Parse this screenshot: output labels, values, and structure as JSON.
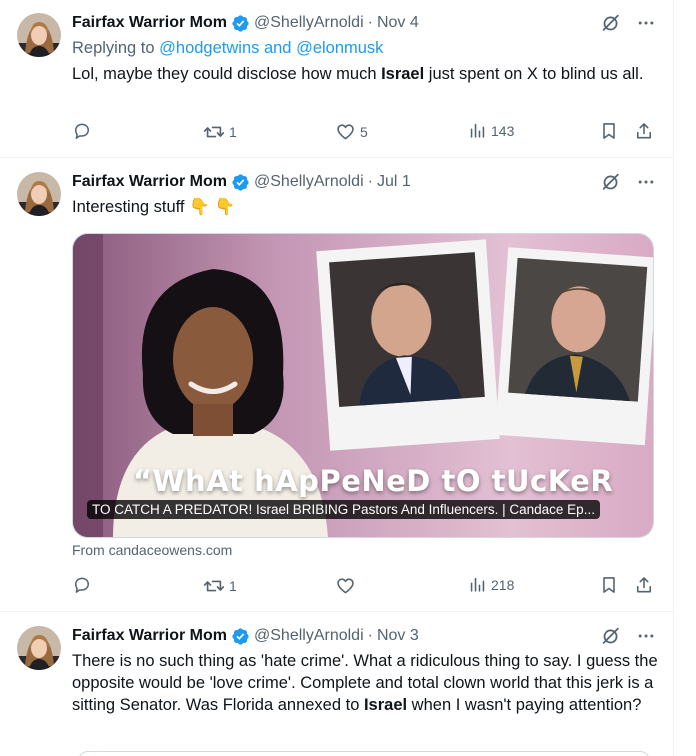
{
  "colors": {
    "accent": "#1d9bf0",
    "muted": "#536471",
    "text": "#0f1419"
  },
  "tweets": [
    {
      "name": "Fairfax Warrior Mom",
      "handle": "@ShellyArnoldi",
      "dot": "·",
      "date": "Nov 4",
      "replying_prefix": "Replying to ",
      "replying_to": "@hodgetwins and @elonmusk",
      "text_before": "Lol, maybe they could disclose how much ",
      "text_bold": "Israel",
      "text_after": " just spent on X to blind us all.",
      "retweets": "1",
      "likes": "5",
      "views": "143"
    },
    {
      "name": "Fairfax Warrior Mom",
      "handle": "@ShellyArnoldi",
      "dot": "·",
      "date": "Jul 1",
      "text": "Interesting stuff",
      "emoji": "👇 👇",
      "card_overlay_title": "“WhAt hApPeNeD tO tUcKeR",
      "card_caption": "TO CATCH A PREDATOR! Israel BRIBING Pastors And Influencers. | Candace Ep...",
      "from_prefix": "From ",
      "from_domain": "candaceowens.com",
      "retweets": "1",
      "likes": "",
      "views": "218"
    },
    {
      "name": "Fairfax Warrior Mom",
      "handle": "@ShellyArnoldi",
      "dot": "·",
      "date": "Nov 3",
      "text_before": "There is no such thing as 'hate crime'.  What a ridiculous thing to say. I guess the opposite would be 'love crime'. Complete and total clown world that this jerk is a sitting Senator. Was Florida annexed to ",
      "text_bold": "Israel",
      "text_after": " when I wasn't paying attention?"
    }
  ]
}
